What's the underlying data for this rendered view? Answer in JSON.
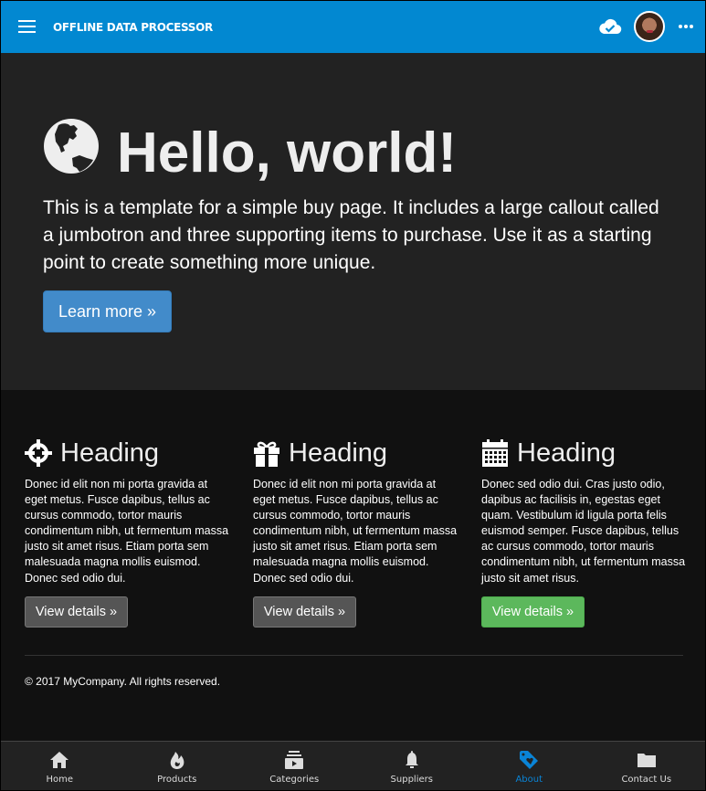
{
  "appbar": {
    "title": "OFFLINE DATA PROCESSOR",
    "menu_icon": "hamburger-icon",
    "sync_icon": "cloud-check-icon",
    "avatar": "user-avatar",
    "more_icon": "more-horizontal-icon",
    "color": "#0288d1"
  },
  "jumbotron": {
    "icon": "globe-icon",
    "title": "Hello, world!",
    "text": "This is a template for a simple buy page. It includes a large callout called a jumbotron and three supporting items to purchase. Use it as a starting point to create something more unique.",
    "button_label": "Learn more »",
    "button_color": "#428bca"
  },
  "columns": [
    {
      "icon": "crosshair-icon",
      "heading": "Heading",
      "text": "Donec id elit non mi porta gravida at eget metus. Fusce dapibus, tellus ac cursus commodo, tortor mauris condimentum nibh, ut fermentum massa justo sit amet risus. Etiam porta sem malesuada magna mollis euismod. Donec sed odio dui.",
      "button_label": "View details »"
    },
    {
      "icon": "gift-icon",
      "heading": "Heading",
      "text": "Donec id elit non mi porta gravida at eget metus. Fusce dapibus, tellus ac cursus commodo, tortor mauris condimentum nibh, ut fermentum massa justo sit amet risus. Etiam porta sem malesuada magna mollis euismod. Donec sed odio dui.",
      "button_label": "View details »"
    },
    {
      "icon": "calendar-icon",
      "heading": "Heading",
      "text": "Donec sed odio dui. Cras justo odio, dapibus ac facilisis in, egestas eget quam. Vestibulum id ligula porta felis euismod semper. Fusce dapibus, tellus ac cursus commodo, tortor mauris condimentum nibh, ut fermentum massa justo sit amet risus.",
      "button_label": "View details »",
      "button_color": "#5cb85c"
    }
  ],
  "footer": {
    "text": "© 2017 MyCompany. All rights reserved."
  },
  "bottom_nav": {
    "active": "About",
    "active_color": "#0a84d6",
    "items": [
      {
        "label": "Home",
        "icon": "home-icon"
      },
      {
        "label": "Products",
        "icon": "flame-icon"
      },
      {
        "label": "Categories",
        "icon": "categories-icon"
      },
      {
        "label": "Suppliers",
        "icon": "bell-icon"
      },
      {
        "label": "About",
        "icon": "tag-heart-icon"
      },
      {
        "label": "Contact Us",
        "icon": "folder-icon"
      }
    ]
  }
}
